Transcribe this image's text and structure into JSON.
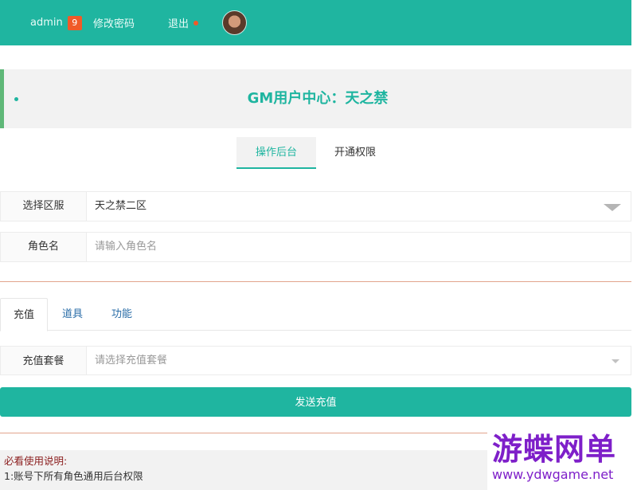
{
  "topbar": {
    "user": "admin",
    "badge_count": "9",
    "change_password": "修改密码",
    "logout": "退出"
  },
  "header": {
    "title": "GM用户中心：天之禁"
  },
  "main_tabs": [
    {
      "label": "操作后台"
    },
    {
      "label": "开通权限"
    }
  ],
  "form": {
    "server_label": "选择区服",
    "server_value": "天之禁二区",
    "role_label": "角色名",
    "role_placeholder": "请输入角色名"
  },
  "sub_tabs": [
    {
      "label": "充值"
    },
    {
      "label": "道具"
    },
    {
      "label": "功能"
    }
  ],
  "recharge": {
    "package_label": "充值套餐",
    "package_placeholder": "请选择充值套餐",
    "send_button": "发送充值"
  },
  "notice": {
    "title": "必看使用说明:",
    "line1": "1:账号下所有角色通用后台权限"
  },
  "watermark": {
    "cn": "游蝶网单",
    "en": "www.ydwgame.net"
  },
  "colors": {
    "accent": "#1fb5a0",
    "badge": "#f05a28",
    "divider": "#e2a48d",
    "watermark": "#7e1fc9"
  }
}
